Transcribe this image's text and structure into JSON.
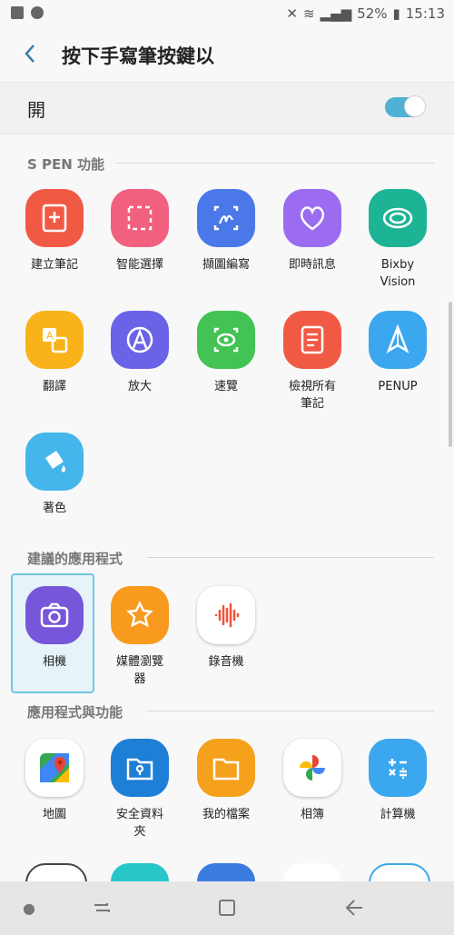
{
  "status": {
    "battery": "52%",
    "time": "15:13"
  },
  "header": {
    "title": "按下手寫筆按鍵以"
  },
  "toggle": {
    "label": "開",
    "on": true
  },
  "sections": {
    "spen": "S PEN 功能",
    "suggested": "建議的應用程式",
    "apps": "應用程式與功能"
  },
  "spen_apps": [
    {
      "label": "建立筆記",
      "icon": "create-note-icon",
      "color": "#f05a45"
    },
    {
      "label": "智能選擇",
      "icon": "smart-select-icon",
      "color": "#f2607f"
    },
    {
      "label": "擷圖編寫",
      "icon": "screen-write-icon",
      "color": "#4a78e8"
    },
    {
      "label": "即時訊息",
      "icon": "live-message-icon",
      "color": "#9b6cf0"
    },
    {
      "label": "Bixby Vision",
      "icon": "bixby-vision-icon",
      "color": "#1db395"
    },
    {
      "label": "翻譯",
      "icon": "translate-icon",
      "color": "#f9b21a"
    },
    {
      "label": "放大",
      "icon": "magnify-icon",
      "color": "#6a63e8"
    },
    {
      "label": "速覽",
      "icon": "glance-icon",
      "color": "#42c353"
    },
    {
      "label": "檢視所有筆記",
      "icon": "view-notes-icon",
      "color": "#f05a45"
    },
    {
      "label": "PENUP",
      "icon": "penup-icon",
      "color": "#3ba7ee"
    },
    {
      "label": "著色",
      "icon": "coloring-icon",
      "color": "#44b6ec"
    }
  ],
  "suggested_apps": [
    {
      "label": "相機",
      "icon": "camera-icon",
      "color": "#7657d9"
    },
    {
      "label": "媒體瀏覽器",
      "icon": "media-browser-icon",
      "color": "#f79a1e"
    },
    {
      "label": "錄音機",
      "icon": "voice-recorder-icon",
      "color": "#ffffff"
    }
  ],
  "apps": [
    {
      "label": "地圖",
      "icon": "maps-icon",
      "color": "#ffffff"
    },
    {
      "label": "安全資料夾",
      "icon": "secure-folder-icon",
      "color": "#1d7fd6"
    },
    {
      "label": "我的檔案",
      "icon": "my-files-icon",
      "color": "#f6a11c"
    },
    {
      "label": "相簿",
      "icon": "photos-icon",
      "color": "#ffffff"
    },
    {
      "label": "計算機",
      "icon": "calculator-icon",
      "color": "#3ba7ee"
    }
  ]
}
